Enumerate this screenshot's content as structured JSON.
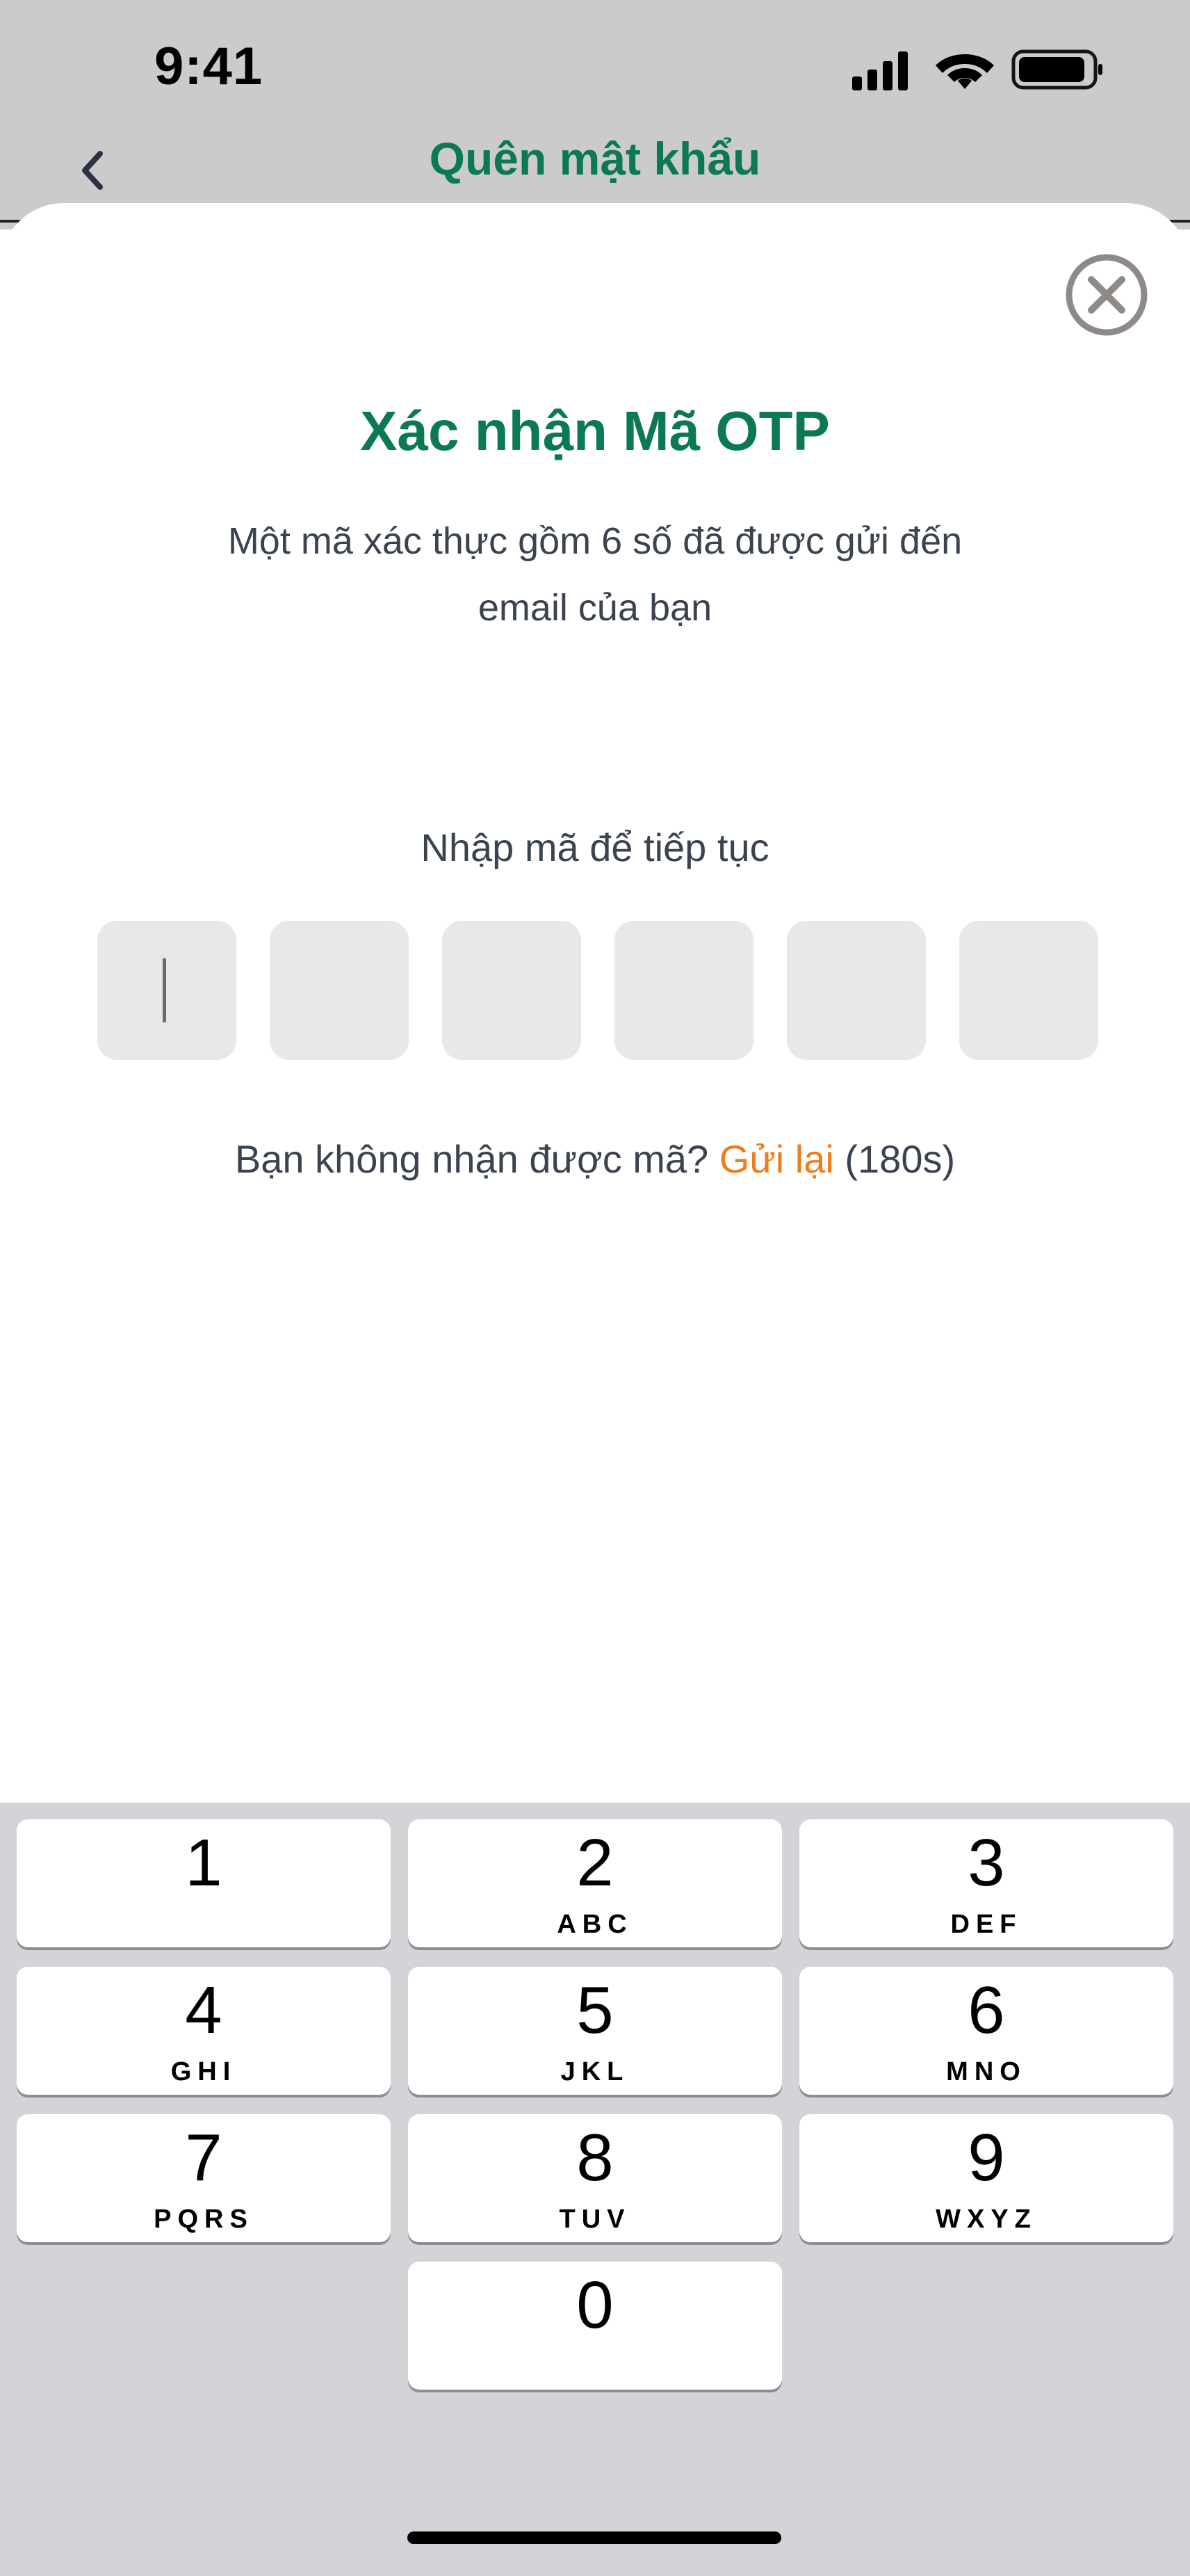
{
  "status_bar": {
    "time": "9:41"
  },
  "nav": {
    "title": "Quên mật khẩu",
    "back_icon": "chevron-left-icon"
  },
  "sheet": {
    "close_icon": "close-circle-icon",
    "title": "Xác nhận Mã OTP",
    "description_line1": "Một mã xác thực gồm 6 số đã được gửi đến",
    "description_line2": "email của bạn",
    "otp_label": "Nhập mã để tiếp tục",
    "otp_digits": [
      "",
      "",
      "",
      "",
      "",
      ""
    ],
    "resend_prompt": "Bạn không nhận được mã? ",
    "resend_link": "Gửi lại",
    "resend_timer": " (180s)"
  },
  "keyboard": {
    "keys": [
      {
        "digit": "1",
        "letters": ""
      },
      {
        "digit": "2",
        "letters": "ABC"
      },
      {
        "digit": "3",
        "letters": "DEF"
      },
      {
        "digit": "4",
        "letters": "GHI"
      },
      {
        "digit": "5",
        "letters": "JKL"
      },
      {
        "digit": "6",
        "letters": "MNO"
      },
      {
        "digit": "7",
        "letters": "PQRS"
      },
      {
        "digit": "8",
        "letters": "TUV"
      },
      {
        "digit": "9",
        "letters": "WXYZ"
      },
      {
        "digit": "0",
        "letters": ""
      }
    ]
  },
  "colors": {
    "brand_green": "#0b7a52",
    "accent_orange": "#f07d1a",
    "otp_box": "#e8e8e8",
    "keyboard_bg": "#d3d4d8"
  }
}
